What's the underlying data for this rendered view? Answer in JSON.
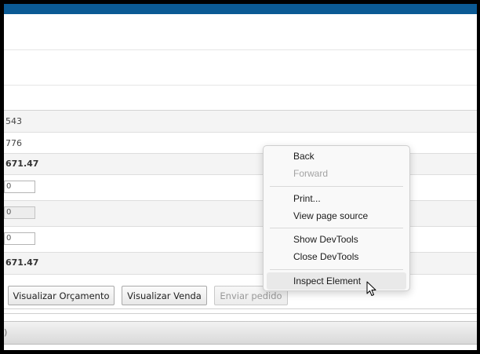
{
  "table": {
    "rows": [
      {
        "text": "543",
        "kind": "text"
      },
      {
        "text": "776",
        "kind": "text"
      },
      {
        "text": "671.47",
        "kind": "bold"
      },
      {
        "text": "0",
        "kind": "input"
      },
      {
        "text": "0",
        "kind": "input-disabled"
      },
      {
        "text": "0",
        "kind": "input"
      },
      {
        "text": "671.47",
        "kind": "bold"
      }
    ]
  },
  "actions": {
    "visualizar_orcamento": "Visualizar Orçamento",
    "visualizar_venda": "Visualizar Venda",
    "enviar_pedido": "Enviar pedido"
  },
  "bottom_bar": {
    "text": ")"
  },
  "context_menu": {
    "back": "Back",
    "forward": "Forward",
    "print": "Print...",
    "view_source": "View page source",
    "show_devtools": "Show DevTools",
    "close_devtools": "Close DevTools",
    "inspect": "Inspect Element"
  },
  "colors": {
    "top_bar": "#0b5a94",
    "menu_bg": "#f9f9f9",
    "hover_bg": "#e9e9e9"
  },
  "icons": {
    "cursor": "mouse-pointer-icon"
  }
}
